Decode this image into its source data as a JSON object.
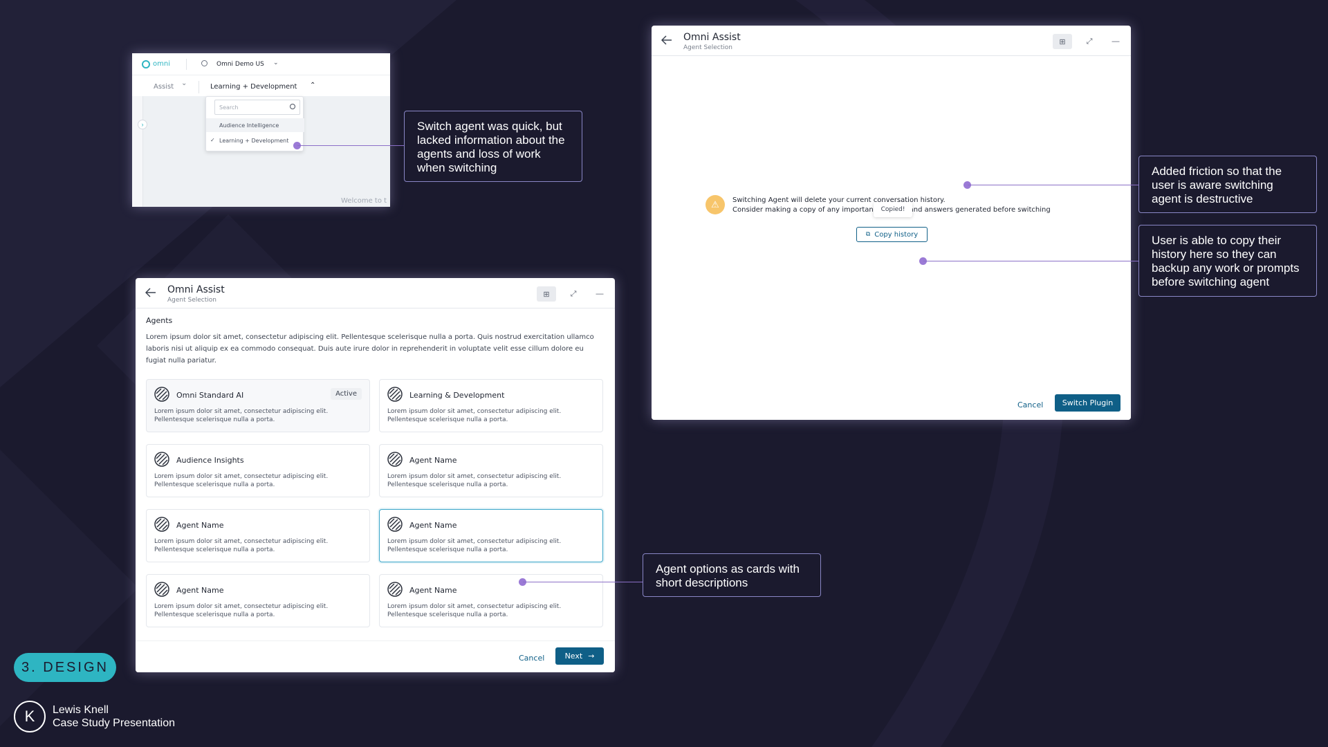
{
  "colors": {
    "background": "#1b1a2e",
    "accent": "#0f5f87",
    "callout_border": "#8a87c7",
    "connector": "#9b7ad6",
    "badge_teal": "#2eb5c2",
    "selected_border": "#3aa6c9"
  },
  "screenshot_small": {
    "logo": "omni",
    "workspace": "Omni Demo US",
    "nav_assist": "Assist",
    "nav_current": "Learning + Development",
    "search_placeholder": "Search",
    "options": [
      "Audience Intelligence",
      "Learning + Development"
    ],
    "footer_text": "Welcome to t"
  },
  "callouts": {
    "switch_agent": "Switch agent was quick, but lacked information about the agents and loss of work when switching",
    "friction": "Added friction so that the user is aware switching agent is destructive",
    "copy_history": "User is able to copy their history here so they can backup any work or prompts before switching agent",
    "agent_cards": "Agent options as cards with short descriptions"
  },
  "agents_window": {
    "title": "Omni Assist",
    "subtitle": "Agent Selection",
    "section_label": "Agents",
    "intro": "Lorem ipsum dolor sit amet, consectetur adipiscing elit. Pellentesque scelerisque nulla a porta. Quis nostrud exercitation ullamco laboris nisi ut aliquip ex ea commodo consequat. Duis aute irure dolor in reprehenderit in voluptate velit esse cillum dolore eu fugiat nulla pariatur.",
    "active_badge": "Active",
    "cards": [
      {
        "name": "Omni Standard AI",
        "desc": "Lorem ipsum dolor sit amet, consectetur adipiscing elit. Pellentesque scelerisque nulla a porta."
      },
      {
        "name": "Learning & Development",
        "desc": "Lorem ipsum dolor sit amet, consectetur adipiscing elit. Pellentesque scelerisque nulla a porta."
      },
      {
        "name": "Audience Insights",
        "desc": "Lorem ipsum dolor sit amet, consectetur adipiscing elit. Pellentesque scelerisque nulla a porta."
      },
      {
        "name": "Agent Name",
        "desc": "Lorem ipsum dolor sit amet, consectetur adipiscing elit. Pellentesque scelerisque nulla a porta."
      },
      {
        "name": "Agent Name",
        "desc": "Lorem ipsum dolor sit amet, consectetur adipiscing elit. Pellentesque scelerisque nulla a porta."
      },
      {
        "name": "Agent Name",
        "desc": "Lorem ipsum dolor sit amet, consectetur adipiscing elit. Pellentesque scelerisque nulla a porta."
      },
      {
        "name": "Agent Name",
        "desc": "Lorem ipsum dolor sit amet, consectetur adipiscing elit. Pellentesque scelerisque nulla a porta."
      },
      {
        "name": "Agent Name",
        "desc": "Lorem ipsum dolor sit amet, consectetur adipiscing elit. Pellentesque scelerisque nulla a porta."
      }
    ],
    "cancel": "Cancel",
    "next": "Next"
  },
  "confirm_window": {
    "title": "Omni Assist",
    "subtitle": "Agent Selection",
    "warning_line1": "Switching Agent will delete your current conversation history.",
    "warning_line2": "Consider making a copy of any important prompts and answers generated before switching",
    "tooltip": "Copied!",
    "copy_button": "Copy history",
    "cancel": "Cancel",
    "switch": "Switch Plugin"
  },
  "section_badge": "3. DESIGN",
  "author": {
    "name": "Lewis Knell",
    "subtitle": "Case Study Presentation",
    "logo_letter": "K"
  }
}
